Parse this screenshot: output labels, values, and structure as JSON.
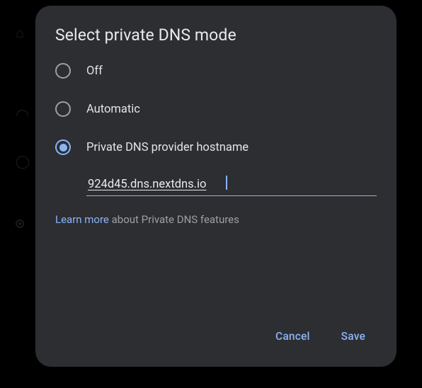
{
  "dialog": {
    "title": "Select private DNS mode",
    "options": {
      "off": "Off",
      "automatic": "Automatic",
      "provider": "Private DNS provider hostname"
    },
    "selected": "provider",
    "hostname_value": "924d45.dns.nextdns.io",
    "hint_link": "Learn more",
    "hint_rest": " about Private DNS features",
    "actions": {
      "cancel": "Cancel",
      "save": "Save"
    }
  }
}
